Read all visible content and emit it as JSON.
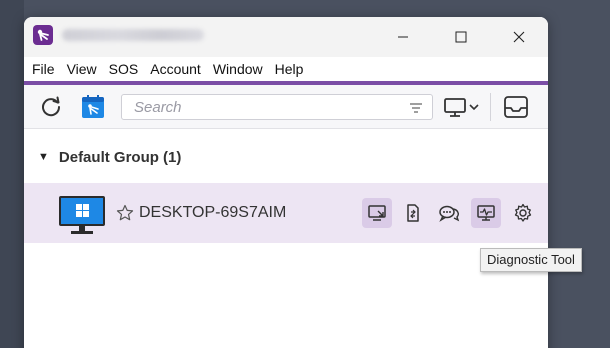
{
  "window": {
    "min_glyph": "—",
    "close_glyph": "✕"
  },
  "menu": [
    {
      "label": "File"
    },
    {
      "label": "View"
    },
    {
      "label": "SOS"
    },
    {
      "label": "Account"
    },
    {
      "label": "Window"
    },
    {
      "label": "Help"
    }
  ],
  "toolbar": {
    "search_placeholder": "Search",
    "icons": [
      "refresh-icon",
      "calendar-icon",
      "filter-icon",
      "monitor-icon",
      "chevron-down-icon",
      "inbox-icon"
    ]
  },
  "group": {
    "caret": "▼",
    "name": "Default Group (1)"
  },
  "device": {
    "name": "DESKTOP-69S7AIM",
    "actions": [
      "remote-control-icon",
      "file-transfer-icon",
      "chat-icon",
      "diagnostic-tool-icon",
      "settings-icon"
    ]
  },
  "tooltip": {
    "text": "Diagnostic Tool"
  },
  "colors": {
    "accent": "#7b4ea6",
    "row_highlight": "#ede5f3",
    "action_highlight": "#dacbe7",
    "windows_blue": "#1e88e5"
  }
}
